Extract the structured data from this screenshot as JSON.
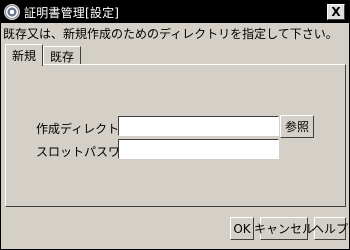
{
  "window": {
    "title": "証明書管理[設定]",
    "close_label": "X"
  },
  "instruction": "既存又は、新規作成のためのディレクトリを指定して下さい。",
  "tabs": [
    {
      "label": "新規",
      "active": true
    },
    {
      "label": "既存",
      "active": false
    }
  ],
  "form": {
    "dir_label": "作成ディレクトリ：",
    "dir_value": "",
    "password_label": "スロットパスワード：",
    "password_value": "",
    "browse_label": "参照"
  },
  "buttons": {
    "ok": "OK",
    "cancel": "キャンセル",
    "help": "ヘルプ"
  }
}
